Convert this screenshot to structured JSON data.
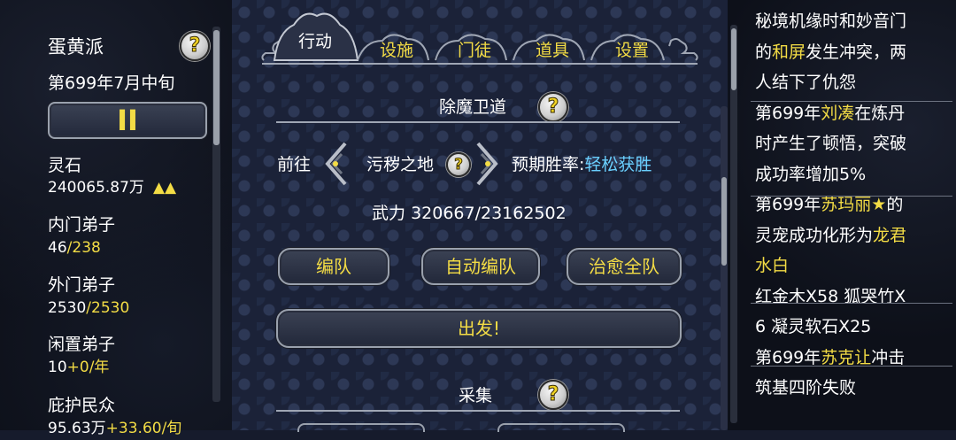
{
  "left": {
    "sect_name": "蛋黄派",
    "date": "第699年7月中旬",
    "pause_symbol": "II",
    "stats": [
      {
        "label": "灵石",
        "value": "240065.87万",
        "extra": "▲▲"
      },
      {
        "label": "内门弟子",
        "value": "46",
        "sep": "/",
        "extra": "238"
      },
      {
        "label": "外门弟子",
        "value": "2530",
        "sep": "/",
        "extra": "2530"
      },
      {
        "label": "闲置弟子",
        "value": "10",
        "extra": "+0/年"
      },
      {
        "label": "庇护民众",
        "value": "95.63万",
        "extra": "+33.60/旬"
      }
    ]
  },
  "tabs": [
    "行动",
    "设施",
    "门徒",
    "道具",
    "设置"
  ],
  "sections": {
    "demon": "除魔卫道",
    "gather": "采集"
  },
  "expedition": {
    "goto_label": "前往",
    "location": "污秽之地",
    "win_label": "预期胜率:",
    "win_value": "轻松获胜",
    "power_label": "武力",
    "power_value": "320667/23162502"
  },
  "buttons": {
    "formation": "编队",
    "auto_formation": "自动编队",
    "heal_all": "治愈全队",
    "depart": "出发!"
  },
  "help_symbol": "?",
  "log": [
    [
      {
        "t": "秘境机缘时和妙音门"
      }
    ],
    [
      {
        "t": "的"
      },
      {
        "t": "和屏",
        "c": "yellow"
      },
      {
        "t": "发生冲突，两"
      }
    ],
    [
      {
        "t": "人结下了仇怨"
      }
    ],
    [
      {
        "t": "第699年"
      },
      {
        "t": "刘凑",
        "c": "yellow"
      },
      {
        "t": "在炼丹"
      }
    ],
    [
      {
        "t": "时产生了顿悟，突破"
      }
    ],
    [
      {
        "t": "成功率增加5%"
      }
    ],
    [
      {
        "t": "第699年"
      },
      {
        "t": "苏玛丽★",
        "c": "yellow"
      },
      {
        "t": "的"
      }
    ],
    [
      {
        "t": "灵宠成功化形为"
      },
      {
        "t": "龙君",
        "c": "yellow"
      }
    ],
    [
      {
        "t": "水白",
        "c": "yellow"
      }
    ],
    [
      {
        "t": "红金木X58 狐哭竹X"
      }
    ],
    [
      {
        "t": "6 凝灵软石X25"
      }
    ],
    [
      {
        "t": "第699年"
      },
      {
        "t": "苏克让",
        "c": "yellow"
      },
      {
        "t": "冲击"
      }
    ],
    [
      {
        "t": "筑基四阶失败"
      }
    ]
  ],
  "colors": {
    "accent_yellow": "#f3dc45",
    "accent_cyan": "#6ad0ff",
    "text": "#ffffff"
  }
}
